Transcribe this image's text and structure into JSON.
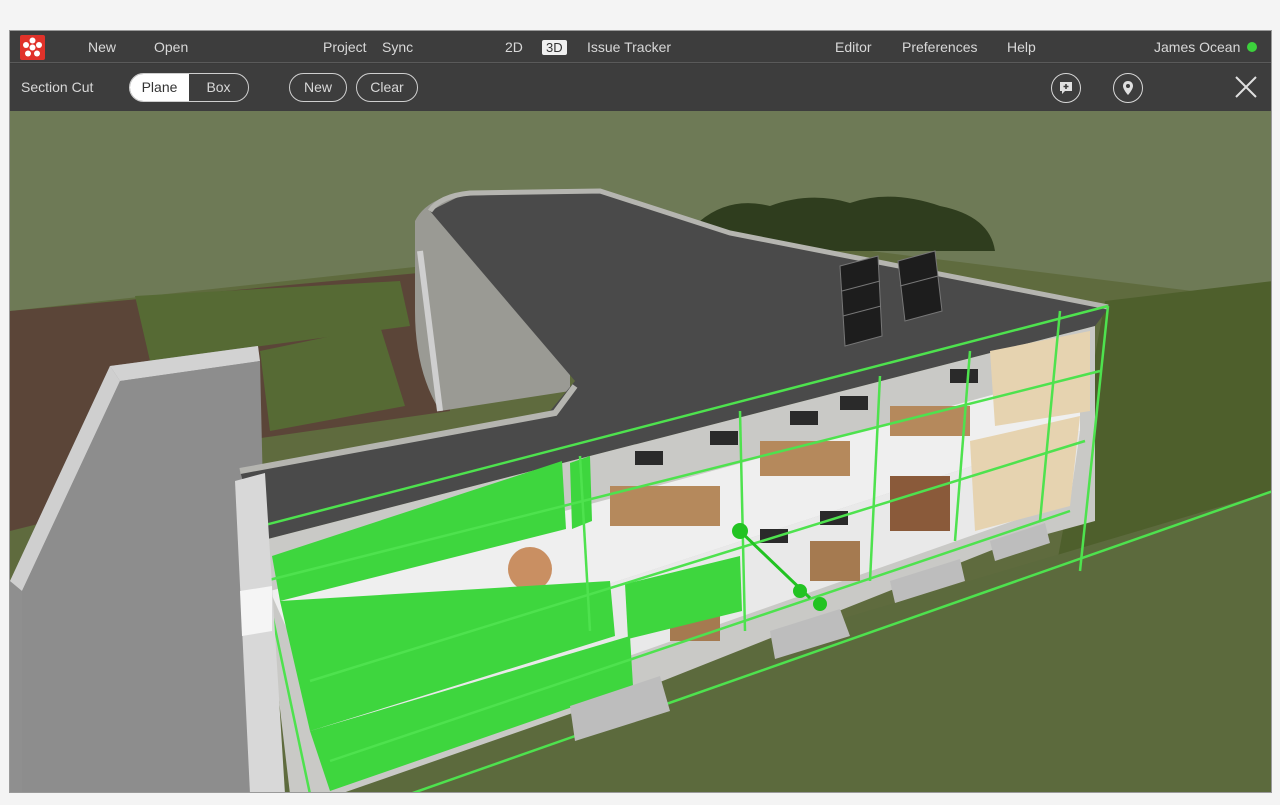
{
  "menubar": {
    "logo": "app-logo-icon",
    "new": "New",
    "open": "Open",
    "project": "Project",
    "sync": "Sync",
    "view_2d": "2D",
    "view_3d": "3D",
    "issue_tracker": "Issue Tracker",
    "editor": "Editor",
    "preferences": "Preferences",
    "help": "Help",
    "user": "James Ocean",
    "status_color": "#3cd13c"
  },
  "toolbar": {
    "section_cut": "Section Cut",
    "plane": "Plane",
    "box": "Box",
    "new": "New",
    "clear": "Clear",
    "icons": [
      "add-comment-icon",
      "location-pin-icon",
      "close-icon"
    ]
  },
  "colors": {
    "accent_green": "#3ed63e",
    "toolbar_bg": "#3d3d3d",
    "logo_red": "#e0322a"
  }
}
